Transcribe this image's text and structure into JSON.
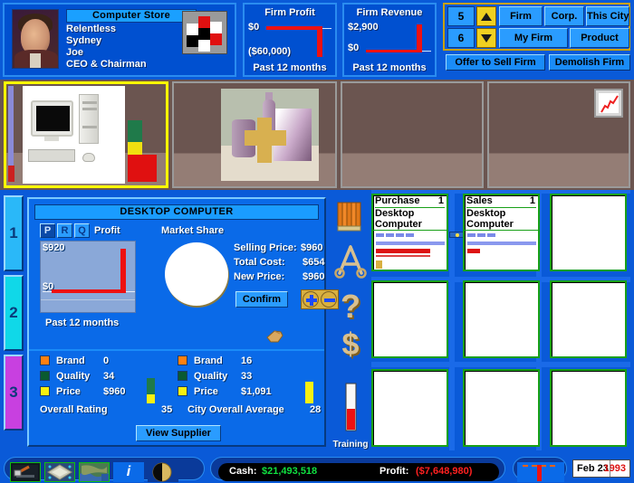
{
  "firm": {
    "name_bar": "Computer Store",
    "line1": "Relentless",
    "line2": "Sydney",
    "line3": "Joe",
    "line4": "CEO & Chairman",
    "portrait_alt": "ceo-portrait",
    "logo_alt": "firm-logo"
  },
  "stats": [
    {
      "title": "Firm Profit",
      "top_value": "$0",
      "bottom_value": "($60,000)",
      "footer": "Past 12 months"
    },
    {
      "title": "Firm Revenue",
      "top_value": "$2,900",
      "bottom_value": "$0",
      "footer": "Past 12 months"
    }
  ],
  "controls": {
    "number_up": "5",
    "number_down": "6",
    "btn_firm": "Firm",
    "btn_corp": "Corp.",
    "btn_this_city": "This City",
    "btn_my_firm": "My Firm",
    "btn_product": "Product",
    "btn_offer_to_sell": "Offer to Sell Firm",
    "btn_demolish": "Demolish Firm"
  },
  "shop_bays": [
    {
      "name": "bay-1-desktop-computer",
      "selected": true,
      "content": "desktop-computer-display"
    },
    {
      "name": "bay-2-still-life",
      "selected": false,
      "content": "still-life-display"
    },
    {
      "name": "bay-3-empty",
      "selected": false,
      "content": "empty"
    },
    {
      "name": "bay-4-empty",
      "selected": false,
      "content": "empty"
    }
  ],
  "side_tabs": [
    {
      "label": "1",
      "color": "#2ab8f8"
    },
    {
      "label": "2",
      "color": "#10d8e8"
    },
    {
      "label": "3",
      "color": "#c840e0"
    }
  ],
  "product": {
    "title": "DESKTOP COMPUTER",
    "prq": [
      {
        "label": "P",
        "active": true
      },
      {
        "label": "R",
        "active": false
      },
      {
        "label": "Q",
        "active": false
      }
    ],
    "profit_label": "Profit",
    "market_share_label": "Market Share",
    "chart_top": "$920",
    "chart_zero": "$0",
    "chart_footer": "Past 12 months",
    "selling_price_label": "Selling Price:",
    "selling_price_value": "$960",
    "total_cost_label": "Total Cost:",
    "total_cost_value": "$654",
    "new_price_label": "New Price:",
    "new_price_value": "$960",
    "confirm_label": "Confirm",
    "plus_label": "+",
    "minus_label": "-",
    "view_supplier_label": "View Supplier",
    "ratings_left": [
      {
        "key": "Brand",
        "value": "0",
        "color": "#ff8010"
      },
      {
        "key": "Quality",
        "value": "34",
        "color": "#0a5a30"
      },
      {
        "key": "Price",
        "value": "$960",
        "color": "#f8f010"
      }
    ],
    "ratings_right": [
      {
        "key": "Brand",
        "value": "16",
        "color": "#ff8010"
      },
      {
        "key": "Quality",
        "value": "33",
        "color": "#0a5a30"
      },
      {
        "key": "Price",
        "value": "$1,091",
        "color": "#f8f010"
      }
    ],
    "overall_rating_label": "Overall Rating",
    "overall_rating_value": "35",
    "city_average_label": "City Overall Average",
    "city_average_value": "28"
  },
  "icon_column": [
    {
      "name": "books-icon",
      "glyph": "books"
    },
    {
      "name": "compass-icon",
      "glyph": "A"
    },
    {
      "name": "question-icon",
      "glyph": "?"
    },
    {
      "name": "dollar-icon",
      "glyph": "$"
    },
    {
      "name": "training-gauge-icon",
      "glyph": "gauge"
    }
  ],
  "training_label": "Training",
  "order_cells": [
    {
      "id": "cell-purchase",
      "header": "Purchase",
      "qty": "1",
      "name_line1": "Desktop",
      "name_line2": "Computer",
      "filled": true,
      "dashes": 4,
      "redbar_width": 60
    },
    {
      "id": "cell-sales",
      "header": "Sales",
      "qty": "1",
      "name_line1": "Desktop",
      "name_line2": "Computer",
      "filled": true,
      "dashes": 3,
      "redbar_width": 14
    },
    {
      "id": "cell-3",
      "filled": false
    },
    {
      "id": "cell-4",
      "filled": false
    },
    {
      "id": "cell-5",
      "filled": false
    },
    {
      "id": "cell-6",
      "filled": false
    },
    {
      "id": "cell-7",
      "filled": false
    },
    {
      "id": "cell-8",
      "filled": false
    },
    {
      "id": "cell-9",
      "filled": false
    }
  ],
  "bottom": {
    "tools": [
      {
        "name": "build-hammer-icon"
      },
      {
        "name": "city-map-icon"
      },
      {
        "name": "world-map-icon"
      },
      {
        "name": "info-icon",
        "glyph": "i"
      },
      {
        "name": "back-dial-icon"
      }
    ],
    "cash_label": "Cash:",
    "cash_value": "$21,493,518",
    "profit_label": "Profit:",
    "profit_value": "($7,648,980)",
    "date_day": "Feb 23",
    "date_year": "1993"
  },
  "colors": {
    "accent_blue": "#0a5ad8",
    "panel_blue": "#0a6ae8",
    "cash_green": "#10e040",
    "loss_red": "#ff2020",
    "gold": "#d8b040",
    "cell_green": "#18a018"
  }
}
